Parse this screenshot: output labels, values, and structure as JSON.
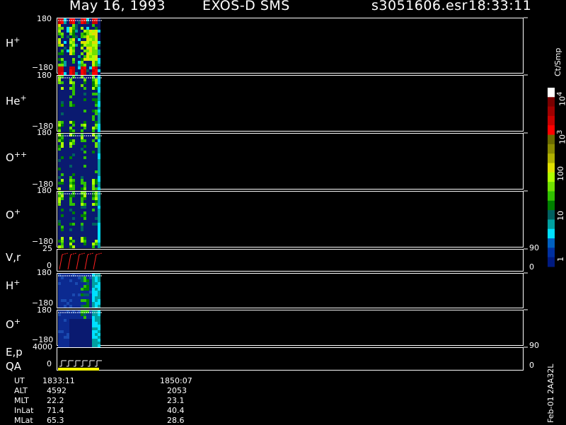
{
  "header": {
    "date": "May 16, 1993",
    "instrument": "EXOS-D SMS",
    "file": "s3051606.esr",
    "time": "18:33:11"
  },
  "panels": [
    {
      "label": "H",
      "sup": "+",
      "ymax": "180",
      "ymin": "−180"
    },
    {
      "label": "He",
      "sup": "+",
      "ymax": "180",
      "ymin": "−180"
    },
    {
      "label": "O",
      "sup": "++",
      "ymax": "180",
      "ymin": "−180"
    },
    {
      "label": "O",
      "sup": "+",
      "ymax": "180",
      "ymin": "−180"
    },
    {
      "label": "V,r",
      "sup": "",
      "ymax": "25",
      "ymin": "0",
      "rmax": "90",
      "rmin": "0"
    },
    {
      "label": "H",
      "sup": "+",
      "ymax": "180",
      "ymin": "−180"
    },
    {
      "label": "O",
      "sup": "+",
      "ymax": "180",
      "ymin": "−180"
    },
    {
      "label": "E,p",
      "label2": "QA",
      "sup": "",
      "ymax": "4000",
      "ymin": "0",
      "rmax": "90",
      "rmin": "0"
    }
  ],
  "colorbar": {
    "unit": "Ct/Smp",
    "ticks": [
      "10",
      "100",
      "10",
      "10",
      "1"
    ],
    "tick_sups": [
      "4",
      "",
      "3",
      "",
      ""
    ],
    "colors": [
      "#ffffff",
      "#7a0000",
      "#a00000",
      "#c80000",
      "#ff0000",
      "#6a6a00",
      "#8a8a00",
      "#b0b000",
      "#e0e000",
      "#b0ff00",
      "#70e000",
      "#30c000",
      "#008000",
      "#006060",
      "#00a0a0",
      "#00e0ff",
      "#0060c0",
      "#0030a0",
      "#001a80"
    ]
  },
  "footer": {
    "rows": [
      {
        "label": "UT",
        "v1": "1833:11",
        "v2": "1850:07"
      },
      {
        "label": "ALT",
        "v1": "4592",
        "v2": "2053"
      },
      {
        "label": "MLT",
        "v1": "22.2",
        "v2": "23.1"
      },
      {
        "label": "InLat",
        "v1": "71.4",
        "v2": "40.4"
      },
      {
        "label": "MLat",
        "v1": "65.3",
        "v2": "28.6"
      }
    ],
    "stamp": "Feb-01 2AA32L"
  },
  "chart_data": {
    "type": "heatmap",
    "title": "May 16, 1993   EXOS-D SMS",
    "subtitle": "s3051606.esr  18:33:11",
    "xlabel": "UT",
    "x_ticks": [
      "1833:11",
      "1850:07"
    ],
    "colorbar_label": "Ct/Smp",
    "colorbar_scale": "log",
    "colorbar_range": [
      1,
      10000
    ],
    "series": [
      {
        "name": "H+",
        "ylim": [
          -180,
          180
        ]
      },
      {
        "name": "He+",
        "ylim": [
          -180,
          180
        ]
      },
      {
        "name": "O++",
        "ylim": [
          -180,
          180
        ]
      },
      {
        "name": "O+",
        "ylim": [
          -180,
          180
        ]
      },
      {
        "name": "V,r",
        "ylim": [
          0,
          25
        ],
        "right_ylim": [
          0,
          90
        ]
      },
      {
        "name": "H+",
        "ylim": [
          -180,
          180
        ]
      },
      {
        "name": "O+",
        "ylim": [
          -180,
          180
        ]
      },
      {
        "name": "E,p QA",
        "ylim": [
          0,
          4000
        ],
        "right_ylim": [
          0,
          90
        ]
      }
    ]
  }
}
